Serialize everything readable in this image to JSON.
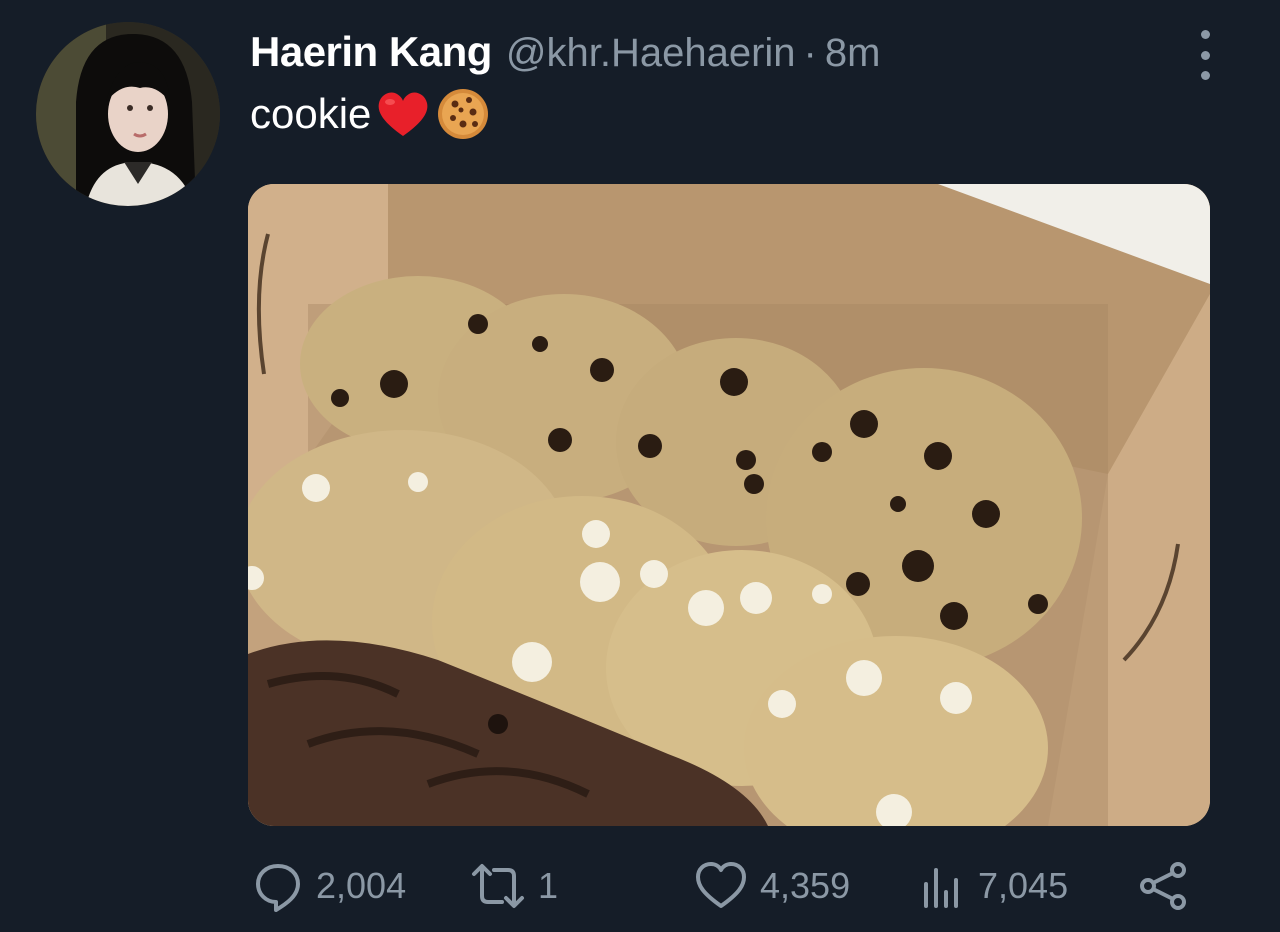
{
  "tweet": {
    "display_name": "Haerin Kang",
    "handle": "@khr.Haehaerin",
    "separator": "·",
    "time": "8m",
    "text": "cookie",
    "emojis": [
      "red-heart",
      "cookie"
    ]
  },
  "media": {
    "description_icon": "photo-of-cookies-in-box"
  },
  "actions": {
    "replies": "2,004",
    "retweets": "1",
    "likes": "4,359",
    "views": "7,045"
  },
  "colors": {
    "background": "#151d28",
    "secondary_text": "#8b98a5",
    "primary_text": "#ffffff",
    "heart": "#e8202a"
  }
}
